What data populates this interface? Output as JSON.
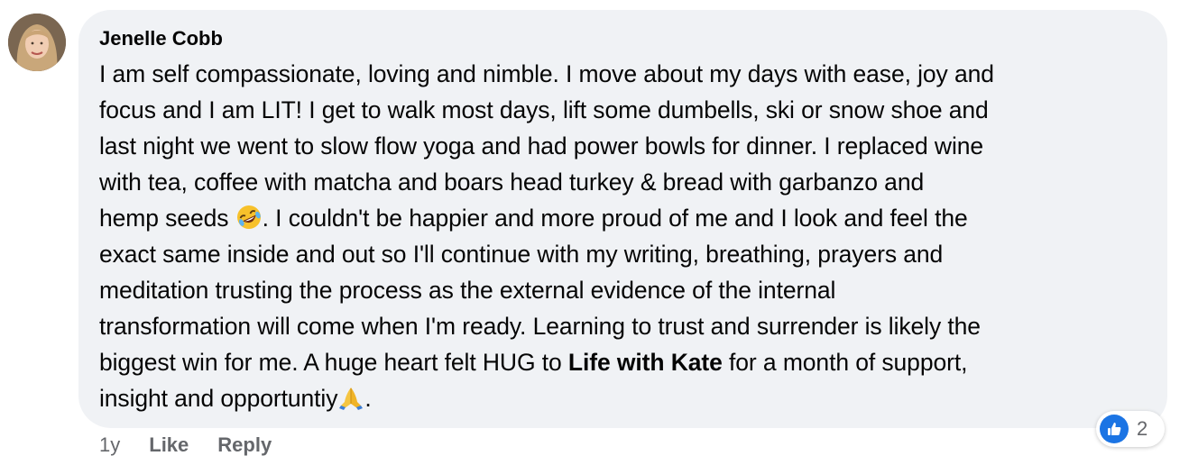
{
  "comment": {
    "author": "Jenelle Cobb",
    "lines": [
      "I am self compassionate, loving and nimble. I move about my days with ease, joy and",
      "focus and I am LIT! I get to walk most days, lift some dumbells, ski or snow shoe and",
      "last night we went to slow flow yoga and had power bowls for dinner. I replaced wine",
      "with tea, coffee with matcha and boars head turkey & bread with garbanzo and"
    ],
    "line5_before_emoji": "hemp seeds ",
    "line5_after_emoji": ". I couldn't be happier and more proud of me and I look and feel the",
    "lines_after": [
      "exact same inside and out so I'll continue with my writing, breathing, prayers and",
      "meditation trusting the process as the external evidence of the internal",
      "transformation will come when I'm ready. Learning to trust and surrender is likely the"
    ],
    "line9_before_mention": "biggest win for me. A huge heart felt HUG to ",
    "mention": "Life with Kate",
    "line9_after_mention": " for a month of support,",
    "line10_before_emoji": "insight and opportuntiy",
    "line10_after_emoji": ".",
    "emojis": [
      "rolling-on-floor-laughing-emoji",
      "folded-hands-emoji"
    ]
  },
  "actions": {
    "timestamp": "1y",
    "like_label": "Like",
    "reply_label": "Reply"
  },
  "reactions": {
    "type": "like",
    "count": "2",
    "color": "#1b74e4"
  },
  "colors": {
    "bubble": "#f0f2f5",
    "text": "#050505",
    "secondary_text": "#65676b"
  }
}
